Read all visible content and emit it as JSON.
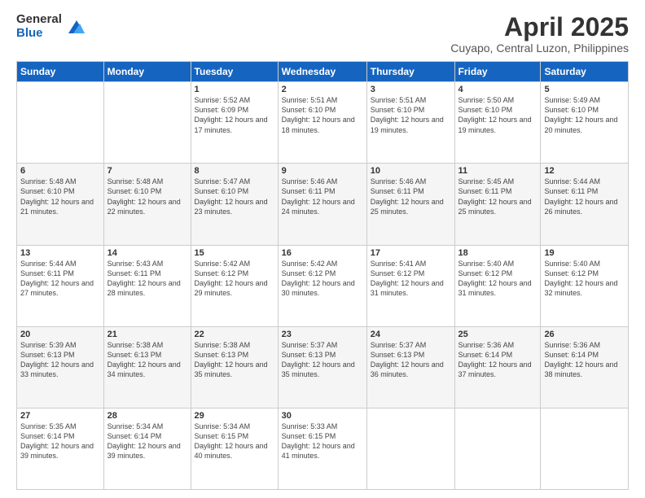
{
  "header": {
    "logo_general": "General",
    "logo_blue": "Blue",
    "month_title": "April 2025",
    "location": "Cuyapo, Central Luzon, Philippines"
  },
  "weekdays": [
    "Sunday",
    "Monday",
    "Tuesday",
    "Wednesday",
    "Thursday",
    "Friday",
    "Saturday"
  ],
  "weeks": [
    [
      {
        "day": "",
        "info": ""
      },
      {
        "day": "",
        "info": ""
      },
      {
        "day": "1",
        "info": "Sunrise: 5:52 AM\nSunset: 6:09 PM\nDaylight: 12 hours and 17 minutes."
      },
      {
        "day": "2",
        "info": "Sunrise: 5:51 AM\nSunset: 6:10 PM\nDaylight: 12 hours and 18 minutes."
      },
      {
        "day": "3",
        "info": "Sunrise: 5:51 AM\nSunset: 6:10 PM\nDaylight: 12 hours and 19 minutes."
      },
      {
        "day": "4",
        "info": "Sunrise: 5:50 AM\nSunset: 6:10 PM\nDaylight: 12 hours and 19 minutes."
      },
      {
        "day": "5",
        "info": "Sunrise: 5:49 AM\nSunset: 6:10 PM\nDaylight: 12 hours and 20 minutes."
      }
    ],
    [
      {
        "day": "6",
        "info": "Sunrise: 5:48 AM\nSunset: 6:10 PM\nDaylight: 12 hours and 21 minutes."
      },
      {
        "day": "7",
        "info": "Sunrise: 5:48 AM\nSunset: 6:10 PM\nDaylight: 12 hours and 22 minutes."
      },
      {
        "day": "8",
        "info": "Sunrise: 5:47 AM\nSunset: 6:10 PM\nDaylight: 12 hours and 23 minutes."
      },
      {
        "day": "9",
        "info": "Sunrise: 5:46 AM\nSunset: 6:11 PM\nDaylight: 12 hours and 24 minutes."
      },
      {
        "day": "10",
        "info": "Sunrise: 5:46 AM\nSunset: 6:11 PM\nDaylight: 12 hours and 25 minutes."
      },
      {
        "day": "11",
        "info": "Sunrise: 5:45 AM\nSunset: 6:11 PM\nDaylight: 12 hours and 25 minutes."
      },
      {
        "day": "12",
        "info": "Sunrise: 5:44 AM\nSunset: 6:11 PM\nDaylight: 12 hours and 26 minutes."
      }
    ],
    [
      {
        "day": "13",
        "info": "Sunrise: 5:44 AM\nSunset: 6:11 PM\nDaylight: 12 hours and 27 minutes."
      },
      {
        "day": "14",
        "info": "Sunrise: 5:43 AM\nSunset: 6:11 PM\nDaylight: 12 hours and 28 minutes."
      },
      {
        "day": "15",
        "info": "Sunrise: 5:42 AM\nSunset: 6:12 PM\nDaylight: 12 hours and 29 minutes."
      },
      {
        "day": "16",
        "info": "Sunrise: 5:42 AM\nSunset: 6:12 PM\nDaylight: 12 hours and 30 minutes."
      },
      {
        "day": "17",
        "info": "Sunrise: 5:41 AM\nSunset: 6:12 PM\nDaylight: 12 hours and 31 minutes."
      },
      {
        "day": "18",
        "info": "Sunrise: 5:40 AM\nSunset: 6:12 PM\nDaylight: 12 hours and 31 minutes."
      },
      {
        "day": "19",
        "info": "Sunrise: 5:40 AM\nSunset: 6:12 PM\nDaylight: 12 hours and 32 minutes."
      }
    ],
    [
      {
        "day": "20",
        "info": "Sunrise: 5:39 AM\nSunset: 6:13 PM\nDaylight: 12 hours and 33 minutes."
      },
      {
        "day": "21",
        "info": "Sunrise: 5:38 AM\nSunset: 6:13 PM\nDaylight: 12 hours and 34 minutes."
      },
      {
        "day": "22",
        "info": "Sunrise: 5:38 AM\nSunset: 6:13 PM\nDaylight: 12 hours and 35 minutes."
      },
      {
        "day": "23",
        "info": "Sunrise: 5:37 AM\nSunset: 6:13 PM\nDaylight: 12 hours and 35 minutes."
      },
      {
        "day": "24",
        "info": "Sunrise: 5:37 AM\nSunset: 6:13 PM\nDaylight: 12 hours and 36 minutes."
      },
      {
        "day": "25",
        "info": "Sunrise: 5:36 AM\nSunset: 6:14 PM\nDaylight: 12 hours and 37 minutes."
      },
      {
        "day": "26",
        "info": "Sunrise: 5:36 AM\nSunset: 6:14 PM\nDaylight: 12 hours and 38 minutes."
      }
    ],
    [
      {
        "day": "27",
        "info": "Sunrise: 5:35 AM\nSunset: 6:14 PM\nDaylight: 12 hours and 39 minutes."
      },
      {
        "day": "28",
        "info": "Sunrise: 5:34 AM\nSunset: 6:14 PM\nDaylight: 12 hours and 39 minutes."
      },
      {
        "day": "29",
        "info": "Sunrise: 5:34 AM\nSunset: 6:15 PM\nDaylight: 12 hours and 40 minutes."
      },
      {
        "day": "30",
        "info": "Sunrise: 5:33 AM\nSunset: 6:15 PM\nDaylight: 12 hours and 41 minutes."
      },
      {
        "day": "",
        "info": ""
      },
      {
        "day": "",
        "info": ""
      },
      {
        "day": "",
        "info": ""
      }
    ]
  ]
}
